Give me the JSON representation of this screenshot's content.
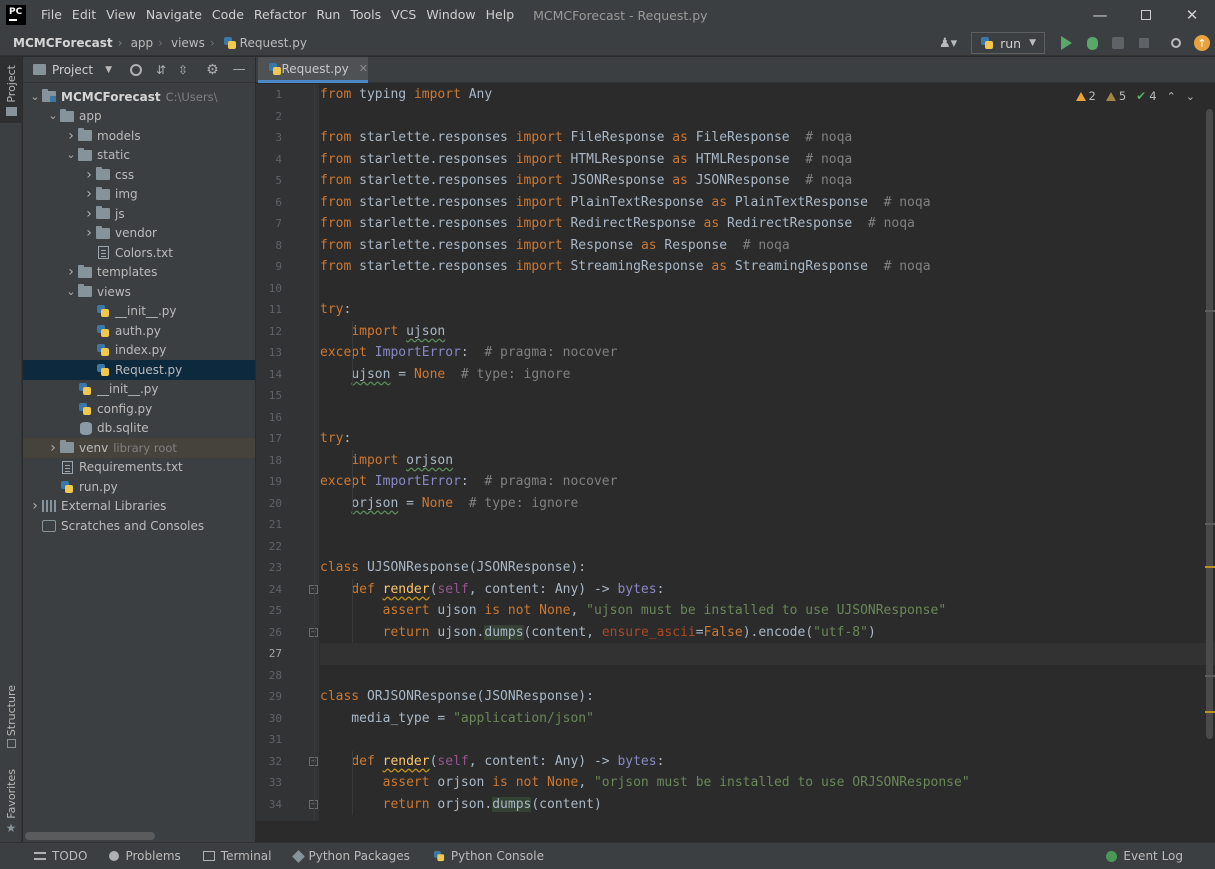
{
  "window": {
    "app_logo": "PC",
    "title": "MCMCForecast - Request.py",
    "menu": [
      "File",
      "Edit",
      "View",
      "Navigate",
      "Code",
      "Refactor",
      "Run",
      "Tools",
      "VCS",
      "Window",
      "Help"
    ]
  },
  "breadcrumb": {
    "items": [
      "MCMCForecast",
      "app",
      "views",
      "Request.py"
    ]
  },
  "toolbar": {
    "run_config": "run"
  },
  "left_stripe": {
    "project": "Project",
    "structure": "Structure",
    "favorites": "Favorites"
  },
  "project_panel": {
    "title": "Project",
    "tree": [
      {
        "label": "MCMCForecast",
        "hint": "C:\\Users\\",
        "depth": 0,
        "type": "root",
        "expanded": true
      },
      {
        "label": "app",
        "depth": 1,
        "type": "folder",
        "expanded": true
      },
      {
        "label": "models",
        "depth": 2,
        "type": "folder",
        "expanded": false
      },
      {
        "label": "static",
        "depth": 2,
        "type": "folder",
        "expanded": true
      },
      {
        "label": "css",
        "depth": 3,
        "type": "folder",
        "expanded": false
      },
      {
        "label": "img",
        "depth": 3,
        "type": "folder",
        "expanded": false
      },
      {
        "label": "js",
        "depth": 3,
        "type": "folder",
        "expanded": false
      },
      {
        "label": "vendor",
        "depth": 3,
        "type": "folder",
        "expanded": false
      },
      {
        "label": "Colors.txt",
        "depth": 3,
        "type": "txt"
      },
      {
        "label": "templates",
        "depth": 2,
        "type": "folder",
        "expanded": false
      },
      {
        "label": "views",
        "depth": 2,
        "type": "folder",
        "expanded": true
      },
      {
        "label": "__init__.py",
        "depth": 3,
        "type": "py"
      },
      {
        "label": "auth.py",
        "depth": 3,
        "type": "py"
      },
      {
        "label": "index.py",
        "depth": 3,
        "type": "py"
      },
      {
        "label": "Request.py",
        "depth": 3,
        "type": "py",
        "selected": true
      },
      {
        "label": "__init__.py",
        "depth": 2,
        "type": "py"
      },
      {
        "label": "config.py",
        "depth": 2,
        "type": "py"
      },
      {
        "label": "db.sqlite",
        "depth": 2,
        "type": "db"
      },
      {
        "label": "venv",
        "hint": "library root",
        "depth": 1,
        "type": "folder",
        "expanded": false,
        "venv": true
      },
      {
        "label": "Requirements.txt",
        "depth": 1,
        "type": "txt"
      },
      {
        "label": "run.py",
        "depth": 1,
        "type": "py"
      },
      {
        "label": "External Libraries",
        "depth": 0,
        "type": "lib",
        "expanded": false
      },
      {
        "label": "Scratches and Consoles",
        "depth": 0,
        "type": "scratch"
      }
    ]
  },
  "editor": {
    "tab": "Request.py",
    "inspections": {
      "warnings": "2",
      "weak_warnings": "5",
      "typos": "4"
    },
    "current_line": 27,
    "lines": [
      [
        [
          "kw",
          "from"
        ],
        [
          "",
          " typing "
        ],
        [
          "kw",
          "import"
        ],
        [
          "",
          " Any"
        ]
      ],
      [],
      [
        [
          "kw",
          "from"
        ],
        [
          "",
          " starlette.responses "
        ],
        [
          "kw",
          "import"
        ],
        [
          "",
          " FileResponse "
        ],
        [
          "kw",
          "as"
        ],
        [
          "",
          " FileResponse  "
        ],
        [
          "cm",
          "# noqa"
        ]
      ],
      [
        [
          "kw",
          "from"
        ],
        [
          "",
          " starlette.responses "
        ],
        [
          "kw",
          "import"
        ],
        [
          "",
          " HTMLResponse "
        ],
        [
          "kw",
          "as"
        ],
        [
          "",
          " HTMLResponse  "
        ],
        [
          "cm",
          "# noqa"
        ]
      ],
      [
        [
          "kw",
          "from"
        ],
        [
          "",
          " starlette.responses "
        ],
        [
          "kw",
          "import"
        ],
        [
          "",
          " JSONResponse "
        ],
        [
          "kw",
          "as"
        ],
        [
          "",
          " JSONResponse  "
        ],
        [
          "cm",
          "# noqa"
        ]
      ],
      [
        [
          "kw",
          "from"
        ],
        [
          "",
          " starlette.responses "
        ],
        [
          "kw",
          "import"
        ],
        [
          "",
          " PlainTextResponse "
        ],
        [
          "kw",
          "as"
        ],
        [
          "",
          " PlainTextResponse  "
        ],
        [
          "cm",
          "# noqa"
        ]
      ],
      [
        [
          "kw",
          "from"
        ],
        [
          "",
          " starlette.responses "
        ],
        [
          "kw",
          "import"
        ],
        [
          "",
          " RedirectResponse "
        ],
        [
          "kw",
          "as"
        ],
        [
          "",
          " RedirectResponse  "
        ],
        [
          "cm",
          "# noqa"
        ]
      ],
      [
        [
          "kw",
          "from"
        ],
        [
          "",
          " starlette.responses "
        ],
        [
          "kw",
          "import"
        ],
        [
          "",
          " Response "
        ],
        [
          "kw",
          "as"
        ],
        [
          "",
          " Response  "
        ],
        [
          "cm",
          "# noqa"
        ]
      ],
      [
        [
          "kw",
          "from"
        ],
        [
          "",
          " starlette.responses "
        ],
        [
          "kw",
          "import"
        ],
        [
          "",
          " StreamingResponse "
        ],
        [
          "kw",
          "as"
        ],
        [
          "",
          " StreamingResponse  "
        ],
        [
          "cm",
          "# noqa"
        ]
      ],
      [],
      [
        [
          "kw",
          "try"
        ],
        [
          "",
          ":"
        ]
      ],
      [
        [
          "",
          "    "
        ],
        [
          "kw",
          "import"
        ],
        [
          "",
          " "
        ],
        [
          "squig",
          "ujson"
        ]
      ],
      [
        [
          "kw",
          "except"
        ],
        [
          "",
          " "
        ],
        [
          "bi",
          "ImportError"
        ],
        [
          "",
          ":  "
        ],
        [
          "cm",
          "# pragma: nocover"
        ]
      ],
      [
        [
          "",
          "    "
        ],
        [
          "squig",
          "ujson"
        ],
        [
          "",
          " = "
        ],
        [
          "kw",
          "None"
        ],
        [
          "",
          "  "
        ],
        [
          "cm",
          "# type: ignore"
        ]
      ],
      [],
      [],
      [
        [
          "kw",
          "try"
        ],
        [
          "",
          ":"
        ]
      ],
      [
        [
          "",
          "    "
        ],
        [
          "kw",
          "import"
        ],
        [
          "",
          " "
        ],
        [
          "squig",
          "orjson"
        ]
      ],
      [
        [
          "kw",
          "except"
        ],
        [
          "",
          " "
        ],
        [
          "bi",
          "ImportError"
        ],
        [
          "",
          ":  "
        ],
        [
          "cm",
          "# pragma: nocover"
        ]
      ],
      [
        [
          "",
          "    "
        ],
        [
          "squig",
          "orjson"
        ],
        [
          "",
          " = "
        ],
        [
          "kw",
          "None"
        ],
        [
          "",
          "  "
        ],
        [
          "cm",
          "# type: ignore"
        ]
      ],
      [],
      [],
      [
        [
          "kw",
          "class"
        ],
        [
          "",
          " UJSONResponse(JSONResponse):"
        ]
      ],
      [
        [
          "",
          "    "
        ],
        [
          "kw",
          "def"
        ],
        [
          "",
          " "
        ],
        [
          "fnsq",
          "render"
        ],
        [
          "",
          "("
        ],
        [
          "sf",
          "self"
        ],
        [
          "",
          ", content: Any) -> "
        ],
        [
          "bi",
          "bytes"
        ],
        [
          "",
          ":"
        ]
      ],
      [
        [
          "",
          "        "
        ],
        [
          "kw",
          "assert"
        ],
        [
          "",
          " ujson "
        ],
        [
          "kw",
          "is not None"
        ],
        [
          "",
          ", "
        ],
        [
          "st",
          "\"ujson must be installed to use UJSONResponse\""
        ]
      ],
      [
        [
          "",
          "        "
        ],
        [
          "kw",
          "return"
        ],
        [
          "",
          " ujson."
        ],
        [
          "hl",
          "dumps"
        ],
        [
          "",
          "(content, "
        ],
        [
          "pm",
          "ensure_ascii"
        ],
        [
          "",
          "="
        ],
        [
          "kw",
          "False"
        ],
        [
          "",
          ").encode("
        ],
        [
          "st",
          "\"utf-8\""
        ],
        [
          "",
          ")"
        ]
      ],
      [],
      [],
      [
        [
          "kw",
          "class"
        ],
        [
          "",
          " ORJSONResponse(JSONResponse):"
        ]
      ],
      [
        [
          "",
          "    media_type = "
        ],
        [
          "st",
          "\"application/json\""
        ]
      ],
      [],
      [
        [
          "",
          "    "
        ],
        [
          "kw",
          "def"
        ],
        [
          "",
          " "
        ],
        [
          "fnsq",
          "render"
        ],
        [
          "",
          "("
        ],
        [
          "sf",
          "self"
        ],
        [
          "",
          ", content: Any) -> "
        ],
        [
          "bi",
          "bytes"
        ],
        [
          "",
          ":"
        ]
      ],
      [
        [
          "",
          "        "
        ],
        [
          "kw",
          "assert"
        ],
        [
          "",
          " orjson "
        ],
        [
          "kw",
          "is not None"
        ],
        [
          "",
          ", "
        ],
        [
          "st",
          "\"orjson must be installed to use ORJSONResponse\""
        ]
      ],
      [
        [
          "",
          "        "
        ],
        [
          "kw",
          "return"
        ],
        [
          "",
          " orjson."
        ],
        [
          "hl",
          "dumps"
        ],
        [
          "",
          "(content)"
        ]
      ]
    ]
  },
  "statusbar": {
    "items": [
      "TODO",
      "Problems",
      "Terminal",
      "Python Packages",
      "Python Console"
    ],
    "event_log": "Event Log"
  }
}
